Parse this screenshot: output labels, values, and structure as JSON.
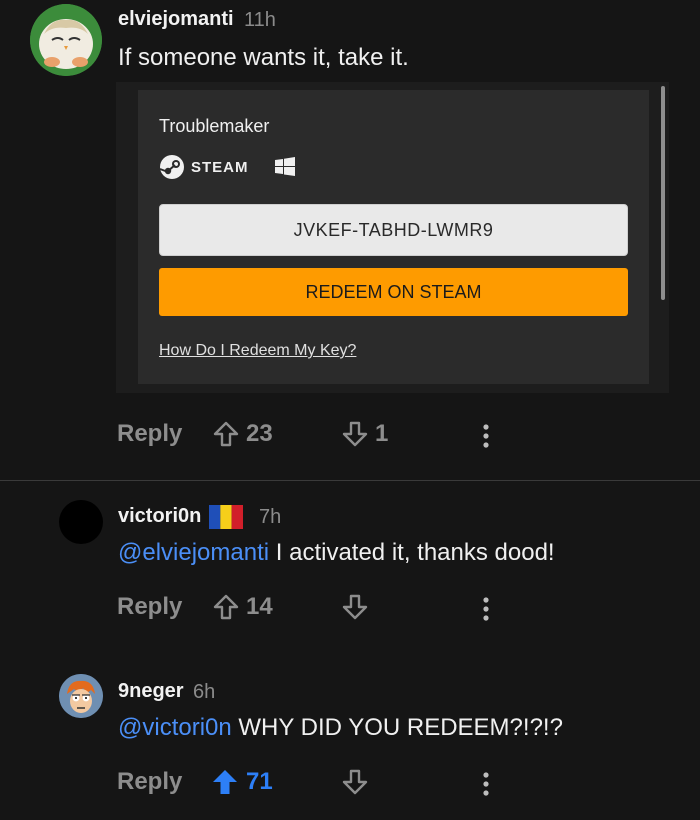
{
  "comments": [
    {
      "username": "elviejomanti",
      "time": "11h",
      "text": "If someone wants it, take it.",
      "embed": {
        "game_title": "Troublemaker",
        "platform": "STEAM",
        "key": "JVKEF-TABHD-LWMR9",
        "redeem_label": "REDEEM ON STEAM",
        "help_link": "How Do I Redeem My Key?"
      },
      "reply_label": "Reply",
      "upvotes": "23",
      "downvotes": "1",
      "upvoted": false
    },
    {
      "username": "victori0n",
      "flag": "romania-flag",
      "time": "7h",
      "mention": "@elviejomanti",
      "text": " I activated it, thanks dood!",
      "reply_label": "Reply",
      "upvotes": "14",
      "downvotes": "",
      "upvoted": false
    },
    {
      "username": "9neger",
      "time": "6h",
      "mention": "@victori0n",
      "text": " WHY DID YOU REDEEM?!?!?",
      "reply_label": "Reply",
      "upvotes": "71",
      "downvotes": "",
      "upvoted": true
    }
  ],
  "colors": {
    "background": "#151515",
    "mention": "#4b8ff7",
    "upvoted": "#2d7ff7",
    "redeem_button": "#fe9b00"
  }
}
